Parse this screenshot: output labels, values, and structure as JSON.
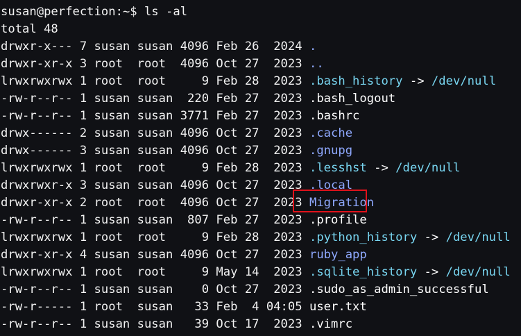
{
  "prompt": "susan@perfection:~$ ls -al",
  "total": "total 48",
  "colors": {
    "background": "#101115",
    "dir": "#8fa9ff",
    "link": "#78d5f0",
    "highlight": "#e0121b"
  },
  "entries": [
    {
      "perm": "drwxr-x---",
      "links": "7",
      "owner": "susan",
      "group": "susan",
      "size": "4096",
      "month": "Feb",
      "day": "26",
      "year": "2024",
      "name": "."
    },
    {
      "perm": "drwxr-xr-x",
      "links": "3",
      "owner": "root",
      "group": "root",
      "size": "4096",
      "month": "Oct",
      "day": "27",
      "year": "2023",
      "name": ".."
    },
    {
      "perm": "lrwxrwxrwx",
      "links": "1",
      "owner": "root",
      "group": "root",
      "size": "9",
      "month": "Feb",
      "day": "28",
      "year": "2023",
      "name": ".bash_history",
      "target": "/dev/null"
    },
    {
      "perm": "-rw-r--r--",
      "links": "1",
      "owner": "susan",
      "group": "susan",
      "size": "220",
      "month": "Feb",
      "day": "27",
      "year": "2023",
      "name": ".bash_logout"
    },
    {
      "perm": "-rw-r--r--",
      "links": "1",
      "owner": "susan",
      "group": "susan",
      "size": "3771",
      "month": "Feb",
      "day": "27",
      "year": "2023",
      "name": ".bashrc"
    },
    {
      "perm": "drwx------",
      "links": "2",
      "owner": "susan",
      "group": "susan",
      "size": "4096",
      "month": "Oct",
      "day": "27",
      "year": "2023",
      "name": ".cache"
    },
    {
      "perm": "drwx------",
      "links": "3",
      "owner": "susan",
      "group": "susan",
      "size": "4096",
      "month": "Oct",
      "day": "27",
      "year": "2023",
      "name": ".gnupg"
    },
    {
      "perm": "lrwxrwxrwx",
      "links": "1",
      "owner": "root",
      "group": "root",
      "size": "9",
      "month": "Feb",
      "day": "28",
      "year": "2023",
      "name": ".lesshst",
      "target": "/dev/null"
    },
    {
      "perm": "drwxrwxr-x",
      "links": "3",
      "owner": "susan",
      "group": "susan",
      "size": "4096",
      "month": "Oct",
      "day": "27",
      "year": "2023",
      "name": ".local"
    },
    {
      "perm": "drwxr-xr-x",
      "links": "2",
      "owner": "root",
      "group": "root",
      "size": "4096",
      "month": "Oct",
      "day": "27",
      "year": "2023",
      "name": "Migration"
    },
    {
      "perm": "-rw-r--r--",
      "links": "1",
      "owner": "susan",
      "group": "susan",
      "size": "807",
      "month": "Feb",
      "day": "27",
      "year": "2023",
      "name": ".profile"
    },
    {
      "perm": "lrwxrwxrwx",
      "links": "1",
      "owner": "root",
      "group": "root",
      "size": "9",
      "month": "Feb",
      "day": "28",
      "year": "2023",
      "name": ".python_history",
      "target": "/dev/null"
    },
    {
      "perm": "drwxr-xr-x",
      "links": "4",
      "owner": "susan",
      "group": "susan",
      "size": "4096",
      "month": "Oct",
      "day": "27",
      "year": "2023",
      "name": "ruby_app"
    },
    {
      "perm": "lrwxrwxrwx",
      "links": "1",
      "owner": "root",
      "group": "root",
      "size": "9",
      "month": "May",
      "day": "14",
      "year": "2023",
      "name": ".sqlite_history",
      "target": "/dev/null"
    },
    {
      "perm": "-rw-r--r--",
      "links": "1",
      "owner": "susan",
      "group": "susan",
      "size": "0",
      "month": "Oct",
      "day": "27",
      "year": "2023",
      "name": ".sudo_as_admin_successful"
    },
    {
      "perm": "-rw-r-----",
      "links": "1",
      "owner": "root",
      "group": "susan",
      "size": "33",
      "month": "Feb",
      "day": "4",
      "year": "04:05",
      "name": "user.txt"
    },
    {
      "perm": "-rw-r--r--",
      "links": "1",
      "owner": "susan",
      "group": "susan",
      "size": "39",
      "month": "Oct",
      "day": "17",
      "year": "2023",
      "name": ".vimrc"
    }
  ],
  "highlighted_entry": "Migration"
}
